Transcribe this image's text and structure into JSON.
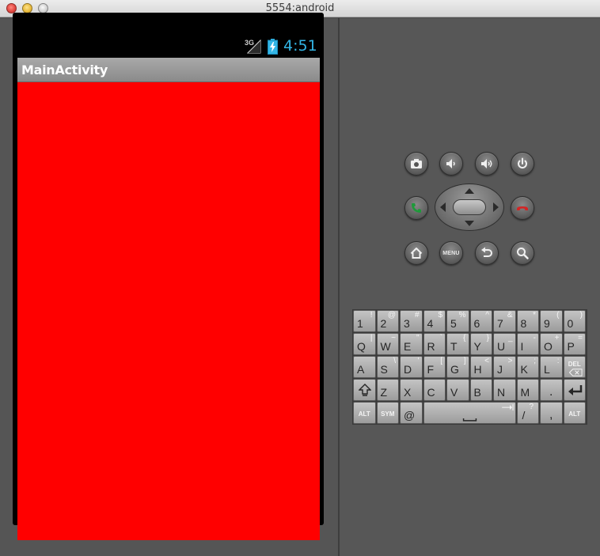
{
  "window": {
    "title": "5554:android"
  },
  "status_bar": {
    "network": "3G",
    "time": "4:51",
    "time_color": "#33b5e5"
  },
  "app": {
    "title": "MainActivity",
    "content_color": "#ff0000"
  },
  "hardware_buttons": {
    "camera": "camera-icon",
    "volume_down": "volume-down-icon",
    "volume_up": "volume-up-icon",
    "power": "power-icon",
    "call": "call-icon",
    "end_call": "end-call-icon",
    "home": "home-icon",
    "menu_label": "MENU",
    "back": "back-icon",
    "search": "search-icon"
  },
  "keyboard": {
    "row1": [
      {
        "main": "1",
        "sub": "!"
      },
      {
        "main": "2",
        "sub": "@"
      },
      {
        "main": "3",
        "sub": "#"
      },
      {
        "main": "4",
        "sub": "$"
      },
      {
        "main": "5",
        "sub": "%"
      },
      {
        "main": "6",
        "sub": "^"
      },
      {
        "main": "7",
        "sub": "&"
      },
      {
        "main": "8",
        "sub": "*"
      },
      {
        "main": "9",
        "sub": "("
      },
      {
        "main": "0",
        "sub": ")"
      }
    ],
    "row2": [
      {
        "main": "Q",
        "sub": "|"
      },
      {
        "main": "W",
        "sub": "~"
      },
      {
        "main": "E",
        "sub": "\""
      },
      {
        "main": "R",
        "sub": "`"
      },
      {
        "main": "T",
        "sub": "{"
      },
      {
        "main": "Y",
        "sub": "}"
      },
      {
        "main": "U",
        "sub": "_"
      },
      {
        "main": "I",
        "sub": "-"
      },
      {
        "main": "O",
        "sub": "+"
      },
      {
        "main": "P",
        "sub": "="
      }
    ],
    "row3": [
      {
        "main": "A",
        "sub": ""
      },
      {
        "main": "S",
        "sub": "\\"
      },
      {
        "main": "D",
        "sub": "'"
      },
      {
        "main": "F",
        "sub": "["
      },
      {
        "main": "G",
        "sub": "]"
      },
      {
        "main": "H",
        "sub": "<"
      },
      {
        "main": "J",
        "sub": ">"
      },
      {
        "main": "K",
        "sub": ";"
      },
      {
        "main": "L",
        "sub": ":"
      }
    ],
    "row3_del": "DEL",
    "row4": [
      "Z",
      "X",
      "C",
      "V",
      "B",
      "N",
      "M",
      "."
    ],
    "row5": {
      "alt_left": "ALT",
      "sym": "SYM",
      "at": "@",
      "slash": "/",
      "slash_sub": "?",
      "comma": ",",
      "alt_right": "ALT"
    }
  }
}
